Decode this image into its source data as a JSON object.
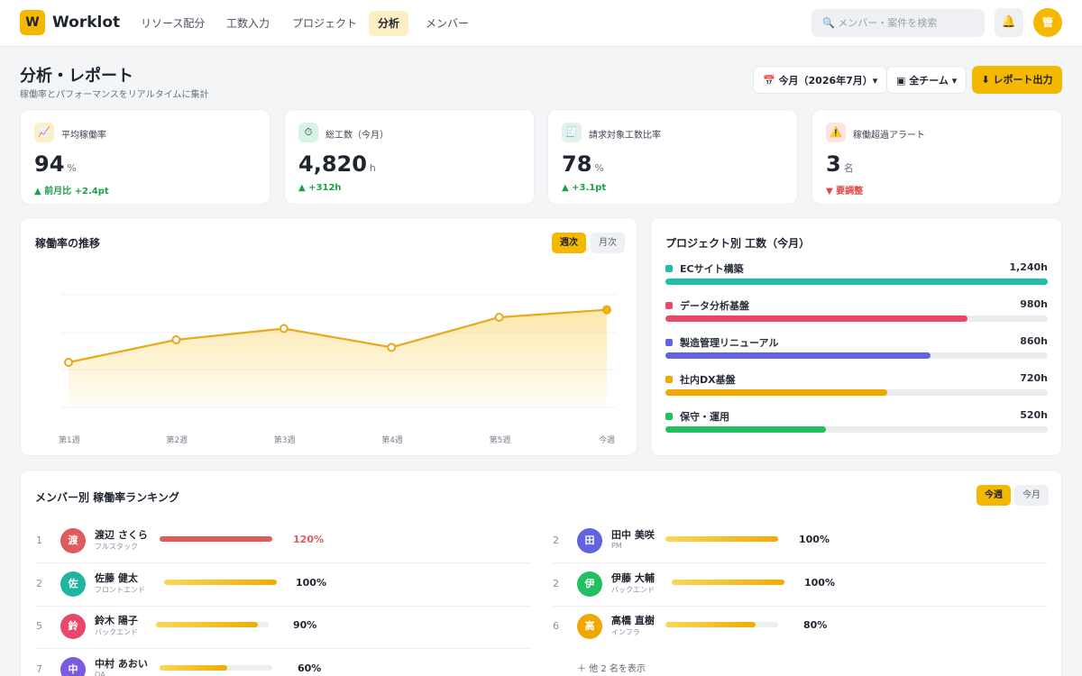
{
  "app": {
    "logo_letter": "W",
    "name": "Worklot"
  },
  "nav": [
    {
      "label": "リソース配分",
      "active": false
    },
    {
      "label": "工数入力",
      "active": false
    },
    {
      "label": "プロジェクト",
      "active": false
    },
    {
      "label": "分析",
      "active": true
    },
    {
      "label": "メンバー",
      "active": false
    }
  ],
  "header": {
    "search_placeholder": "🔍 メンバー・案件を検索",
    "bell_icon": "🔔",
    "user_initial": "管"
  },
  "page": {
    "title": "分析・レポート",
    "subtitle": "稼働率とパフォーマンスをリアルタイムに集計",
    "period_filter": "📅 今月（2026年7月）▾",
    "team_filter": "▣ 全チーム ▾",
    "export_button": "⬇ レポート出力"
  },
  "kpis": [
    {
      "icon": "📈",
      "icon_bg": "#fdefc3",
      "label": "平均稼働率",
      "value": "94",
      "unit": "%",
      "delta": "▲ 前月比 +2.4pt",
      "delta_color": "#1e9e4a"
    },
    {
      "icon": "⏱",
      "icon_bg": "#d7f3e6",
      "label": "総工数（今月）",
      "value": "4,820",
      "unit": "h",
      "delta": "▲ +312h",
      "delta_color": "#1e9e4a"
    },
    {
      "icon": "🧾",
      "icon_bg": "#e3f1e8",
      "label": "請求対象工数比率",
      "value": "78",
      "unit": "%",
      "delta": "▲ +3.1pt",
      "delta_color": "#1e9e4a"
    },
    {
      "icon": "⚠️",
      "icon_bg": "#fde3e3",
      "label": "稼働超過アラート",
      "value": "3",
      "unit": "名",
      "delta": "▼ 要調整",
      "delta_color": "#e04848"
    }
  ],
  "trend": {
    "title": "稼働率の推移",
    "toggle_weekly": "週次",
    "toggle_monthly": "月次",
    "line_color": "#e8a91a",
    "chart_data": {
      "type": "area",
      "categories": [
        "第1週",
        "第2週",
        "第3週",
        "第4週",
        "第5週",
        "今週"
      ],
      "values": [
        82,
        88,
        91,
        86,
        94,
        96
      ],
      "ylim": [
        70,
        100
      ],
      "grid": true
    }
  },
  "projects": {
    "title": "プロジェクト別 工数（今月）",
    "items": [
      {
        "name": "ECサイト構築",
        "hours": "1,240h",
        "value": 1240,
        "color": "#1fbfa6"
      },
      {
        "name": "データ分析基盤",
        "hours": "980h",
        "value": 980,
        "color": "#e8496b"
      },
      {
        "name": "製造管理リニューアル",
        "hours": "860h",
        "value": 860,
        "color": "#6163e0"
      },
      {
        "name": "社内DX基盤",
        "hours": "720h",
        "value": 720,
        "color": "#f0a800"
      },
      {
        "name": "保守・運用",
        "hours": "520h",
        "value": 520,
        "color": "#22c060"
      }
    ],
    "max_value": 1240
  },
  "ranking": {
    "title": "メンバー別 稼働率ランキング",
    "toggle_week": "今週",
    "toggle_month": "今月",
    "left": [
      {
        "rank": "1",
        "initial": "渡",
        "name": "渡辺 さくら",
        "role": "フルスタック",
        "pct": "120%",
        "value": 1.0,
        "avatar": "#e05b5b",
        "bar": "#e05b5b",
        "pct_color": "#e05b5b"
      },
      {
        "rank": "2",
        "initial": "佐",
        "name": "佐藤 健太",
        "role": "フロントエンド",
        "pct": "100%",
        "value": 1.0,
        "avatar": "#1fb5a0",
        "bar": "#f5b800",
        "pct_color": "#1f2430"
      },
      {
        "rank": "5",
        "initial": "鈴",
        "name": "鈴木 陽子",
        "role": "バックエンド",
        "pct": "90%",
        "value": 0.9,
        "avatar": "#e8496b",
        "bar": "#f5b800",
        "pct_color": "#1f2430"
      },
      {
        "rank": "7",
        "initial": "中",
        "name": "中村 あおい",
        "role": "QA",
        "pct": "60%",
        "value": 0.6,
        "avatar": "#7a5ae0",
        "bar": "#f5b800",
        "pct_color": "#1f2430"
      }
    ],
    "right": [
      {
        "rank": "2",
        "initial": "田",
        "name": "田中 美咲",
        "role": "PM",
        "pct": "100%",
        "value": 1.0,
        "avatar": "#6163e0",
        "bar": "#f5b800",
        "pct_color": "#1f2430"
      },
      {
        "rank": "2",
        "initial": "伊",
        "name": "伊藤 大輔",
        "role": "バックエンド",
        "pct": "100%",
        "value": 1.0,
        "avatar": "#22c060",
        "bar": "#f5b800",
        "pct_color": "#1f2430"
      },
      {
        "rank": "6",
        "initial": "高",
        "name": "高橋 直樹",
        "role": "インフラ",
        "pct": "80%",
        "value": 0.8,
        "avatar": "#f0a800",
        "bar": "#f5b800",
        "pct_color": "#1f2430"
      }
    ],
    "more_link": "＋ 他 2 名を表示"
  }
}
